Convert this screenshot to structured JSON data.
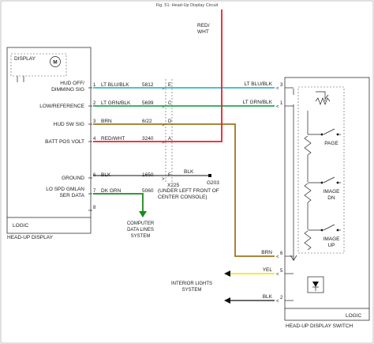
{
  "title": "Fig. 51: Head-Up Display Circuit",
  "top_wire": "RED/\nWHT",
  "hud": {
    "display_label": "DISPLAY",
    "motor_symbol": "M",
    "logic_label": "LOGIC",
    "caption": "HEAD-UP DISPLAY",
    "circuits": [
      {
        "label": "HUD OFF/\nDIMMING SIG",
        "pin": "1",
        "color_name": "LT BLU/BLK",
        "circuit": "5812",
        "connector_pin": "E",
        "color": "#33b8d6"
      },
      {
        "label": "LOW/REFERENCE",
        "pin": "2",
        "color_name": "LT GRN/BLK",
        "circuit": "5699",
        "connector_pin": "C",
        "color": "#22aa55"
      },
      {
        "label": "HUD SW SIG",
        "pin": "3",
        "color_name": "BRN",
        "circuit": "6/22",
        "connector_pin": "D",
        "color": "#a0741c"
      },
      {
        "label": "BATT POS VOLT",
        "pin": "4",
        "color_name": "RED/WHT",
        "circuit": "3240",
        "connector_pin": "A",
        "color": "#e8202a"
      },
      {
        "label": "GROUND",
        "pin": "6",
        "color_name": "BLK",
        "circuit": "1650",
        "connector_pin": "F",
        "color": "#111111"
      },
      {
        "label": "LO SPD GMLAN\nSER DATA",
        "pin": "7",
        "color_name": "DK GRN",
        "circuit": "5060",
        "connector_pin": "",
        "color": "#1a8a1a"
      },
      {
        "label": "",
        "pin": "8",
        "color_name": "",
        "circuit": "",
        "connector_pin": "",
        "color": ""
      }
    ]
  },
  "ground": {
    "wire": "BLK",
    "connector": "X225",
    "ground_id": "G203",
    "location": "(UNDER LEFT FRONT OF\nCENTER CONSOLE)"
  },
  "data_lines_label": "COMPUTER\nDATA LINES\nSYSTEM",
  "switch": {
    "caption": "HEAD-UP DISPLAY SWITCH",
    "logic_label": "LOGIC",
    "pins": [
      {
        "pin": "3",
        "color_name": "LT BLU/BLK",
        "color": "#33b8d6"
      },
      {
        "pin": "1",
        "color_name": "LT GRN/BLK",
        "color": "#22aa55"
      },
      {
        "pin": "6",
        "color_name": "BRN",
        "color": "#a0741c"
      },
      {
        "pin": "5",
        "color_name": "YEL",
        "color": "#f2e81a"
      },
      {
        "pin": "2",
        "color_name": "BLK",
        "color": "#111111"
      }
    ],
    "buttons": [
      "PAGE",
      "IMAGE\nDN",
      "IMAGE\nUP"
    ]
  },
  "interior_lights_label": "INTERIOR LIGHTS\nSYSTEM"
}
